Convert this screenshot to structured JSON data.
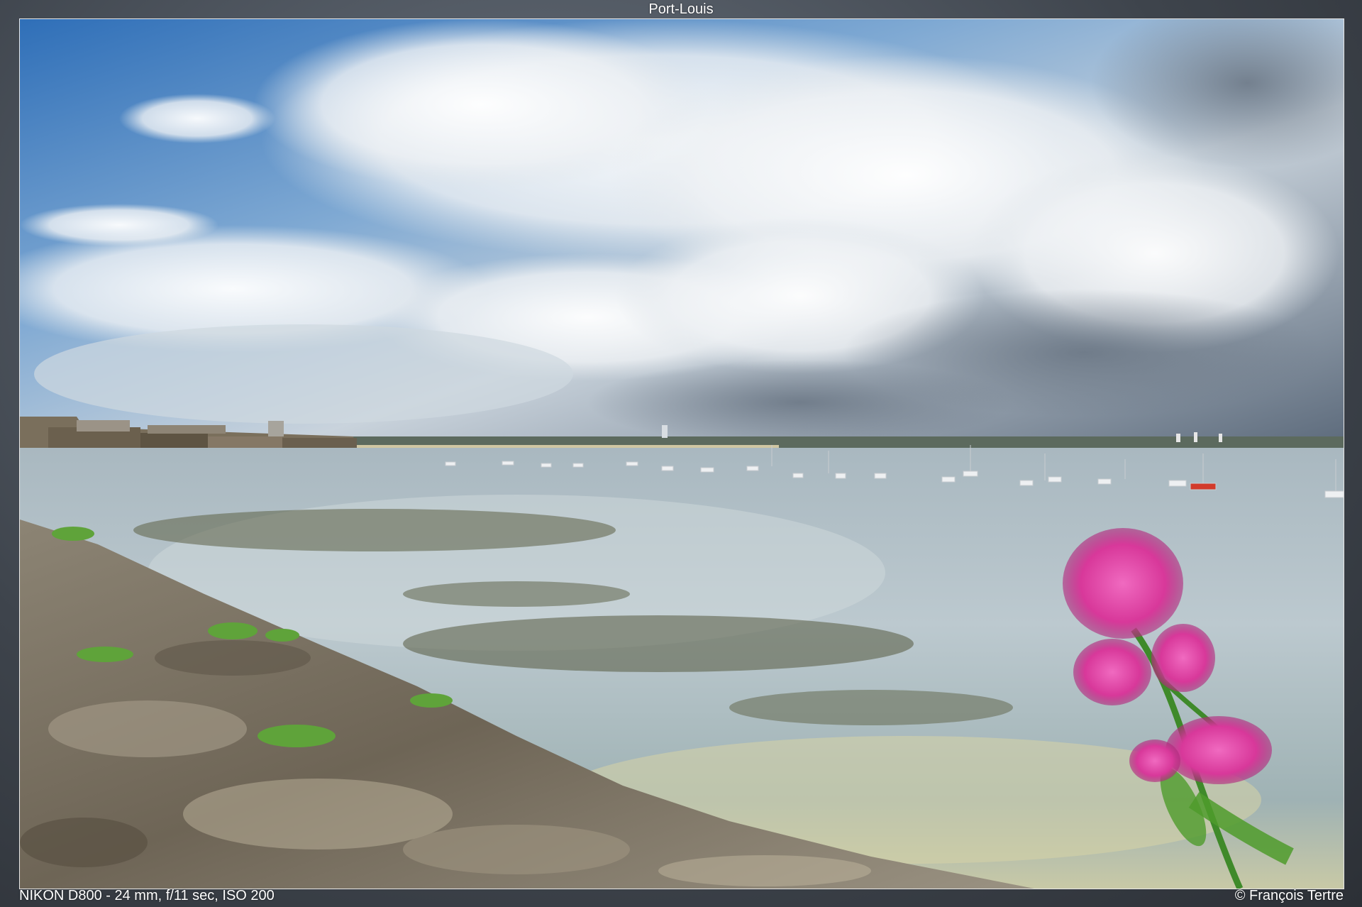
{
  "header": {
    "title": "Port-Louis"
  },
  "footer": {
    "exif": "NIKON D800 - 24 mm, f/11 sec, ISO 200",
    "copyright": "© François Tertre"
  },
  "colors": {
    "sky_blue": "#3f7fc4",
    "cloud_white": "#eef1f4",
    "cloud_gray": "#8a96a4",
    "water": "#b9c6cc",
    "rock": "#7d7466",
    "flower": "#d8389a",
    "leaf": "#4f9b2c"
  }
}
